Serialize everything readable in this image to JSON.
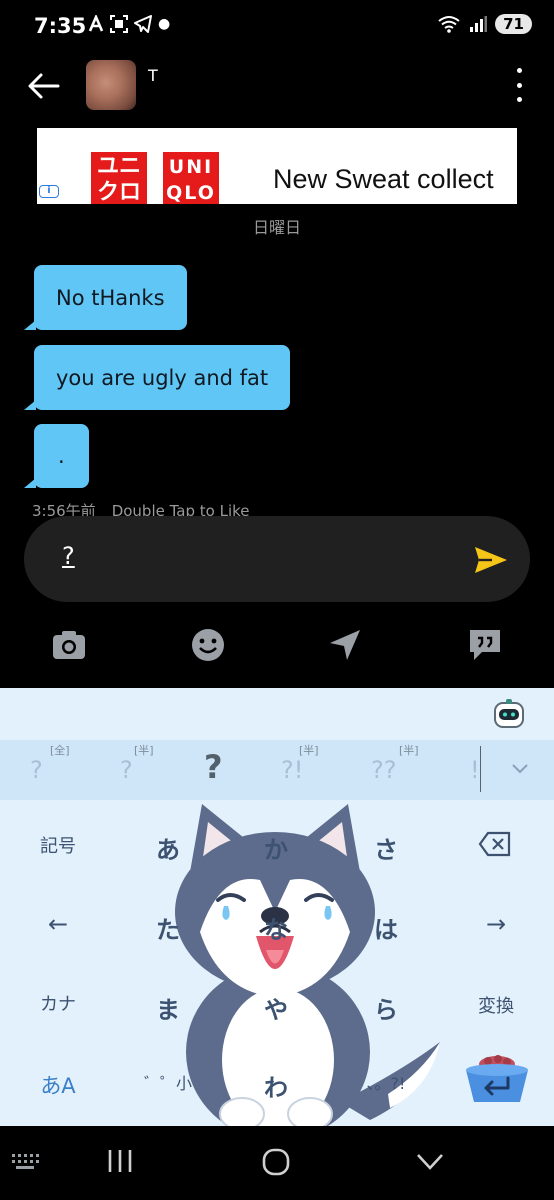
{
  "status_bar": {
    "time": "7:35",
    "battery": "71",
    "icons": [
      "a-icon",
      "scan-icon",
      "telegram-icon",
      "dot-icon",
      "wifi-icon",
      "signal-icon"
    ]
  },
  "header": {
    "contact_name": "T"
  },
  "ad": {
    "logo_line1": "ユニ\nクロ",
    "logo_line2": "UNI\nQLO",
    "text": "New Sweat collect"
  },
  "chat": {
    "day_label": "日曜日",
    "messages": [
      {
        "text": "No tHanks"
      },
      {
        "text": "you are ugly and fat"
      },
      {
        "text": "."
      }
    ],
    "timestamp": "3:56午前",
    "hint": "Double Tap to Like"
  },
  "composer": {
    "value": "?"
  },
  "keyboard": {
    "candidates": [
      {
        "text": "?",
        "tag": "[全]"
      },
      {
        "text": "?",
        "tag": "[半]"
      },
      {
        "text": "?",
        "tag": ""
      },
      {
        "text": "?!",
        "tag": "[半]"
      },
      {
        "text": "??",
        "tag": "[半]"
      },
      {
        "text": "!",
        "tag": ""
      }
    ],
    "keys": {
      "symbols": "記号",
      "a": "あ",
      "ka": "か",
      "sa": "さ",
      "left": "←",
      "ta": "た",
      "na": "な",
      "ha": "は",
      "right": "→",
      "kana": "カナ",
      "ma": "ま",
      "ya": "や",
      "ra": "ら",
      "convert": "変換",
      "mode": "あA",
      "dakuten": "゛゜小",
      "wa": "わ",
      "punct": "、。?!"
    }
  },
  "colors": {
    "bubble": "#5fc6f6",
    "send": "#f5c518",
    "keyboard_bg": "#e3f1fc",
    "candidate_bg": "#cfe5f8"
  }
}
